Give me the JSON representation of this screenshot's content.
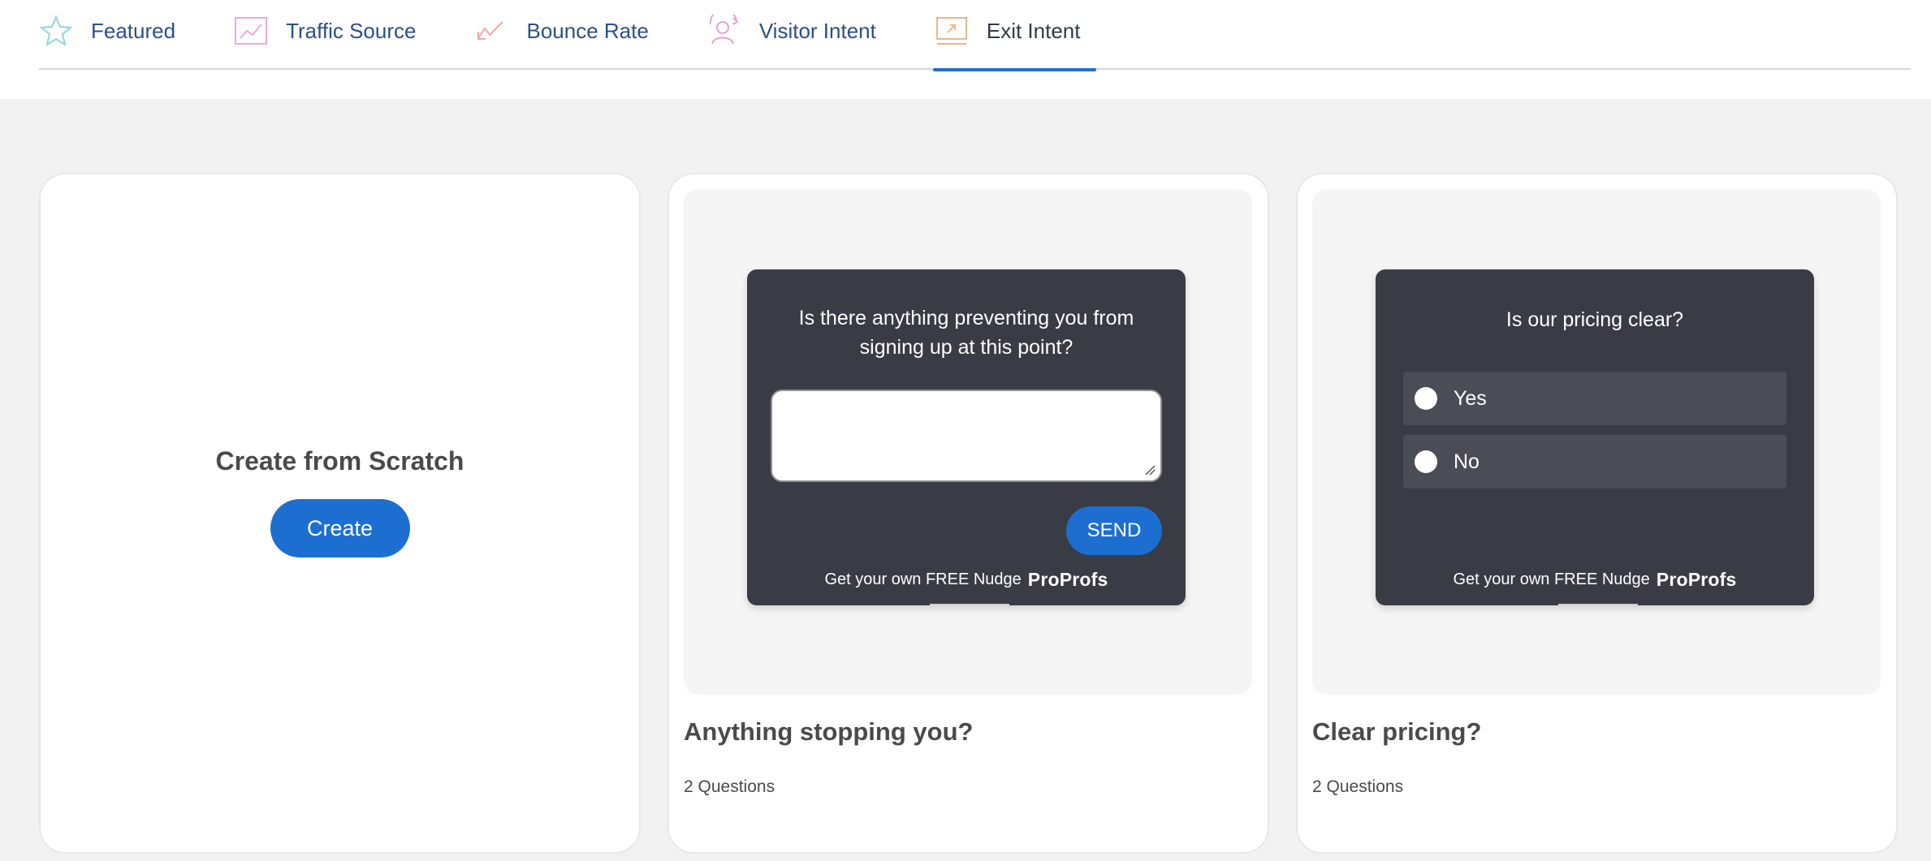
{
  "tabs": [
    {
      "label": "Featured",
      "icon": "star-icon",
      "color": "#8fd6d9"
    },
    {
      "label": "Traffic Source",
      "icon": "line-chart-icon",
      "color": "#e7a9e7"
    },
    {
      "label": "Bounce Rate",
      "icon": "trend-down-icon",
      "color": "#f0a8a0"
    },
    {
      "label": "Visitor Intent",
      "icon": "visitor-icon",
      "color": "#e6a1d3"
    },
    {
      "label": "Exit Intent",
      "icon": "exit-screen-icon",
      "color": "#f0b38b",
      "active": true
    }
  ],
  "scratch": {
    "title": "Create from Scratch",
    "button_label": "Create"
  },
  "templates": [
    {
      "title": "Anything stopping you?",
      "meta": "2 Questions",
      "preview": {
        "question": "Is there anything preventing you from signing up at this point?",
        "send_label": "SEND",
        "footer_text": "Get your own FREE Nudge",
        "brand": "ProProfs"
      }
    },
    {
      "title": "Clear pricing?",
      "meta": "2 Questions",
      "preview": {
        "question": "Is our pricing clear?",
        "options": [
          "Yes",
          "No"
        ],
        "footer_text": "Get your own FREE Nudge",
        "brand": "ProProfs"
      }
    }
  ],
  "colors": {
    "accent": "#1c6fd1",
    "nudge_bg": "#393c44",
    "page_bg": "#f2f2f2",
    "tab_text": "#2b4f8a"
  }
}
